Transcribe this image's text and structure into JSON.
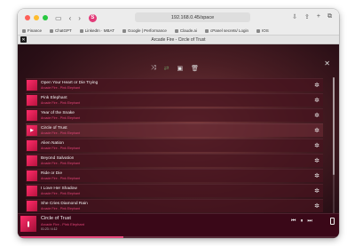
{
  "browser": {
    "url": "192.168.0.45/space",
    "tab_avatar": "S",
    "tab_title": "Arcade Fire - Circle of Trust",
    "bookmarks": [
      "Finance",
      "ChatGPT",
      "LinkedIn · MBAT",
      "Google | Performance",
      "Claude.ai",
      "cPanel secrets/ Login",
      "IOS"
    ]
  },
  "toolbar": {
    "shuffle": "⤨",
    "repeat": "⇄",
    "save": "▣",
    "delete": "🗑"
  },
  "playlist": [
    {
      "title": "Open Your Heart or Die Trying",
      "subtitle": "Arcade Fire - Pink Elephant"
    },
    {
      "title": "Pink Elephant",
      "subtitle": "Arcade Fire - Pink Elephant"
    },
    {
      "title": "Year of the Snake",
      "subtitle": "Arcade Fire - Pink Elephant"
    },
    {
      "title": "Circle of Trust",
      "subtitle": "Arcade Fire - Pink Elephant"
    },
    {
      "title": "Alien Nation",
      "subtitle": "Arcade Fire - Pink Elephant"
    },
    {
      "title": "Beyond Salvation",
      "subtitle": "Arcade Fire - Pink Elephant"
    },
    {
      "title": "Ride or Die",
      "subtitle": "Arcade Fire - Pink Elephant"
    },
    {
      "title": "I Love Her Shadow",
      "subtitle": "Arcade Fire - Pink Elephant"
    },
    {
      "title": "She Cries Diamond Rain",
      "subtitle": "Arcade Fire - Pink Elephant"
    }
  ],
  "active_index": 3,
  "player": {
    "title": "Circle of Trust",
    "subtitle": "Arcade Fire - Pink Elephant",
    "time": "01:23 / 4:12",
    "progress": 0.33
  },
  "icons": {
    "gear": "gear-icon",
    "close": "close-icon"
  }
}
